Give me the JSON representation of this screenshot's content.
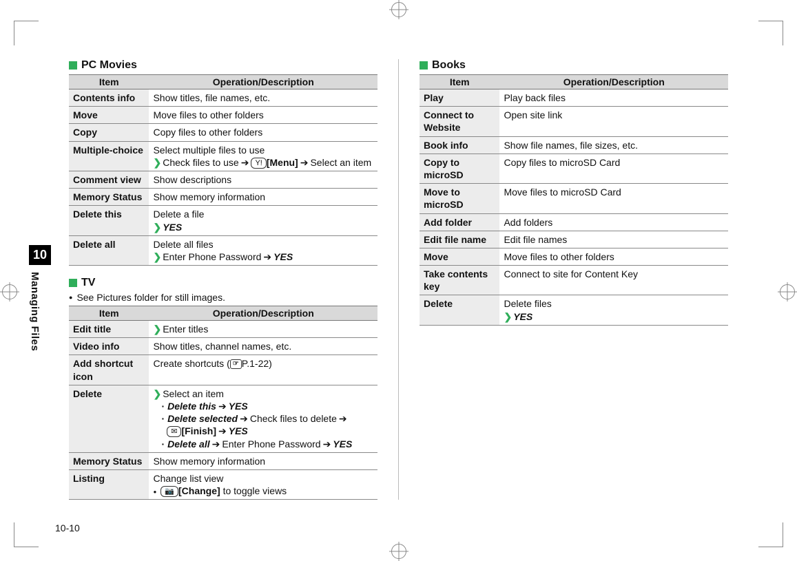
{
  "sidebar": {
    "chapter": "10",
    "title": "Managing Files"
  },
  "pagenum": "10-10",
  "sections": {
    "pcmovies": {
      "title": "PC Movies",
      "header": {
        "item": "Item",
        "op": "Operation/Description"
      },
      "rows": {
        "r0": {
          "item": "Contents info",
          "op": "Show titles, file names, etc."
        },
        "r1": {
          "item": "Move",
          "op": "Move files to other folders"
        },
        "r2": {
          "item": "Copy",
          "op": "Copy files to other folders"
        },
        "r3": {
          "item": "Multiple-choice",
          "lead": "Select multiple files to use",
          "step": "Check files to use",
          "key": "Y!",
          "menu": "[Menu]",
          "tail": "Select an item"
        },
        "r4": {
          "item": "Comment view",
          "op": "Show descriptions"
        },
        "r5": {
          "item": "Memory Status",
          "op": "Show memory information"
        },
        "r6": {
          "item": "Delete this",
          "op": "Delete a file",
          "yes": "YES"
        },
        "r7": {
          "item": "Delete all",
          "op": "Delete all files",
          "step": "Enter Phone Password",
          "yes": "YES"
        }
      }
    },
    "tv": {
      "title": "TV",
      "note": "See Pictures folder for still images.",
      "header": {
        "item": "Item",
        "op": "Operation/Description"
      },
      "rows": {
        "r0": {
          "item": "Edit title",
          "step": "Enter titles"
        },
        "r1": {
          "item": "Video info",
          "op": "Show titles, channel names, etc."
        },
        "r2": {
          "item": "Add shortcut icon",
          "op": "Create shortcuts (",
          "ref": "☞",
          "page": "P.1-22",
          "close": ")"
        },
        "r3": {
          "item": "Delete",
          "lead": "Select an item",
          "d1a": "Delete this",
          "d1y": "YES",
          "d2a": "Delete selected",
          "d2b": "Check files to delete",
          "d2key": "✉",
          "d2fin": "[Finish]",
          "d2y": "YES",
          "d3a": "Delete all",
          "d3b": "Enter Phone Password",
          "d3y": "YES"
        },
        "r4": {
          "item": "Memory Status",
          "op": "Show memory information"
        },
        "r5": {
          "item": "Listing",
          "op": "Change list view",
          "key": "📷",
          "chg": "[Change]",
          "tail": " to toggle views"
        }
      }
    },
    "books": {
      "title": "Books",
      "header": {
        "item": "Item",
        "op": "Operation/Description"
      },
      "rows": {
        "r0": {
          "item": "Play",
          "op": "Play back files"
        },
        "r1": {
          "item": "Connect to Website",
          "op": "Open site link"
        },
        "r2": {
          "item": "Book info",
          "op": "Show file names, file sizes, etc."
        },
        "r3": {
          "item": "Copy to microSD",
          "op": "Copy files to microSD Card"
        },
        "r4": {
          "item": "Move to microSD",
          "op": "Move files to microSD Card"
        },
        "r5": {
          "item": "Add folder",
          "op": "Add folders"
        },
        "r6": {
          "item": "Edit file name",
          "op": "Edit file names"
        },
        "r7": {
          "item": "Move",
          "op": "Move files to other folders"
        },
        "r8": {
          "item": "Take contents key",
          "op": "Connect to site for Content Key"
        },
        "r9": {
          "item": "Delete",
          "op": "Delete files",
          "yes": "YES"
        }
      }
    }
  }
}
